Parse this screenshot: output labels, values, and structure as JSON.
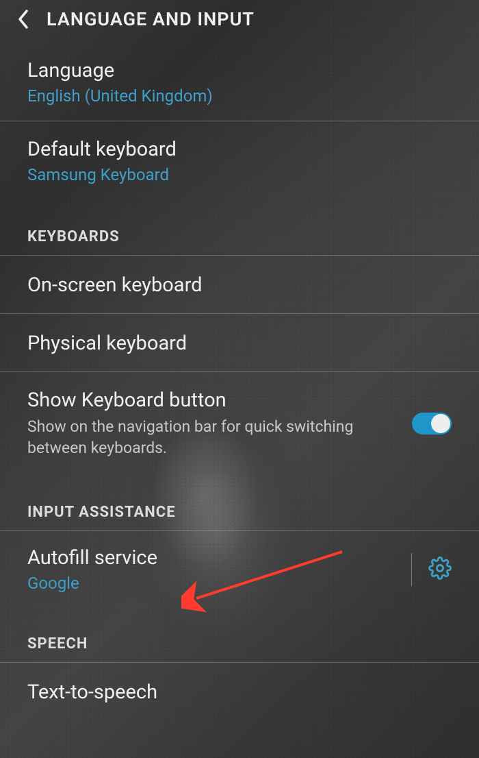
{
  "header": {
    "title": "LANGUAGE AND INPUT"
  },
  "language": {
    "title": "Language",
    "value": "English (United Kingdom)"
  },
  "default_keyboard": {
    "title": "Default keyboard",
    "value": "Samsung Keyboard"
  },
  "sections": {
    "keyboards": "KEYBOARDS",
    "input_assistance": "INPUT ASSISTANCE",
    "speech": "SPEECH"
  },
  "on_screen_keyboard": {
    "title": "On-screen keyboard"
  },
  "physical_keyboard": {
    "title": "Physical keyboard"
  },
  "show_keyboard_button": {
    "title": "Show Keyboard button",
    "description": "Show on the navigation bar for quick switching between keyboards.",
    "enabled": true
  },
  "autofill": {
    "title": "Autofill service",
    "value": "Google"
  },
  "text_to_speech": {
    "title": "Text-to-speech"
  },
  "colors": {
    "accent": "#3ea0c9",
    "toggle_on": "#2196c9",
    "annotation_arrow": "#ff3b30"
  }
}
